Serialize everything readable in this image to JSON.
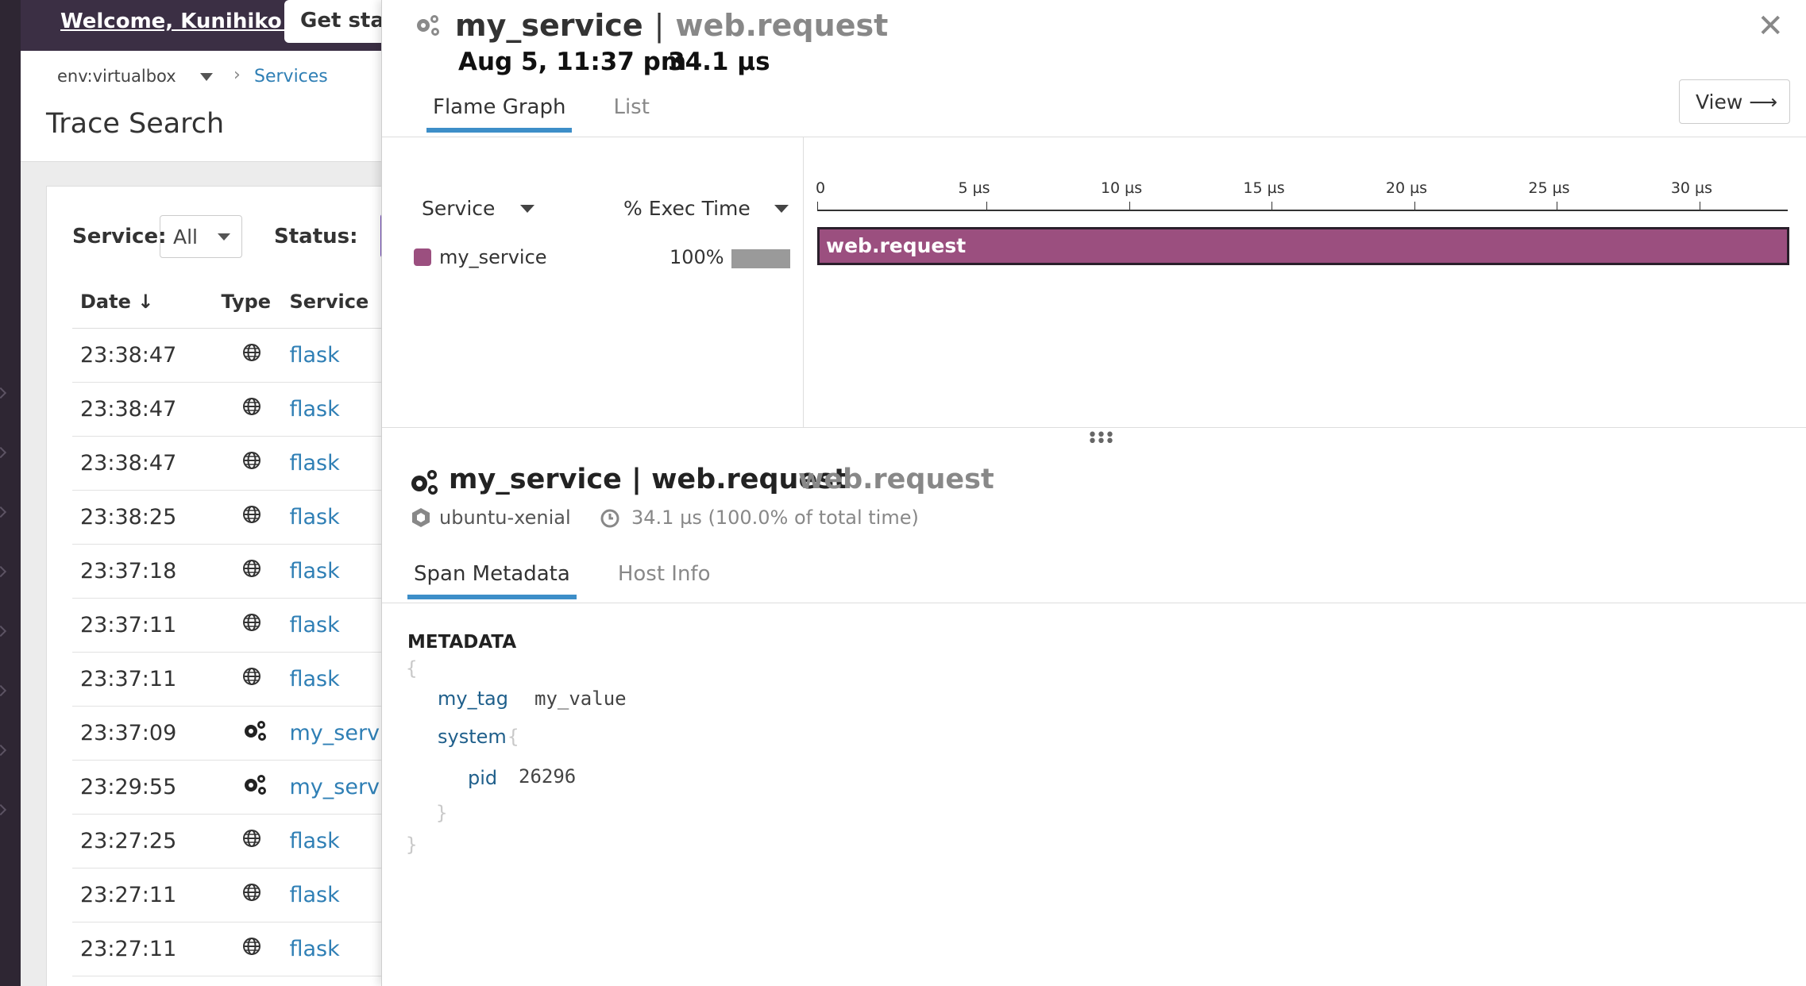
{
  "left_app": {
    "welcome": "Welcome, Kunihiko!",
    "get_started": "Get started",
    "env": "env:virtualbox",
    "breadcrumb": "Services",
    "page_title": "Trace Search",
    "filter_service_label": "Service:",
    "filter_service_value": "All",
    "filter_status_label": "Status:",
    "columns": {
      "date": "Date ↓",
      "type": "Type",
      "service": "Service"
    },
    "rows": [
      {
        "date": "23:38:47",
        "type_icon": "globe-icon",
        "service": "flask"
      },
      {
        "date": "23:38:47",
        "type_icon": "globe-icon",
        "service": "flask"
      },
      {
        "date": "23:38:47",
        "type_icon": "globe-icon",
        "service": "flask"
      },
      {
        "date": "23:38:25",
        "type_icon": "globe-icon",
        "service": "flask"
      },
      {
        "date": "23:37:18",
        "type_icon": "globe-icon",
        "service": "flask"
      },
      {
        "date": "23:37:11",
        "type_icon": "globe-icon",
        "service": "flask"
      },
      {
        "date": "23:37:11",
        "type_icon": "globe-icon",
        "service": "flask"
      },
      {
        "date": "23:37:09",
        "type_icon": "gears-icon",
        "service": "my_service"
      },
      {
        "date": "23:29:55",
        "type_icon": "gears-icon",
        "service": "my_service"
      },
      {
        "date": "23:27:25",
        "type_icon": "globe-icon",
        "service": "flask"
      },
      {
        "date": "23:27:11",
        "type_icon": "globe-icon",
        "service": "flask"
      },
      {
        "date": "23:27:11",
        "type_icon": "globe-icon",
        "service": "flask"
      }
    ]
  },
  "panel": {
    "service": "my_service",
    "separator": "|",
    "resource": "web.request",
    "date": "Aug 5, 11:37 pm",
    "duration": "34.1 µs",
    "tabs": [
      "Flame Graph",
      "List"
    ],
    "view_button": "View ⟶",
    "flame": {
      "service_col": "Service",
      "exec_col": "% Exec Time",
      "service_row": {
        "name": "my_service",
        "pct": "100%",
        "pct_value": 100,
        "color": "#9b4f7f"
      },
      "axis_ticks": [
        "0",
        "5 µs",
        "10 µs",
        "15 µs",
        "20 µs",
        "25 µs",
        "30 µs"
      ],
      "axis_tick_values": [
        0,
        5,
        10,
        15,
        20,
        25,
        30
      ],
      "axis_max": 34.1,
      "span_bar": {
        "label": "web.request",
        "start": 0,
        "end": 34.1
      }
    },
    "span": {
      "title": "my_service | web.request",
      "resource": "web.request",
      "host": "ubuntu-xenial",
      "duration": "34.1 µs (100.0% of total time)",
      "tabs": [
        "Span Metadata",
        "Host Info"
      ],
      "metadata_heading": "METADATA",
      "open_brace": "{",
      "close_brace": "}",
      "meta": {
        "my_tag_key": "my_tag",
        "my_tag_value": "my_value",
        "system_key": "system",
        "pid_key": "pid",
        "pid_value": "26296"
      }
    }
  }
}
